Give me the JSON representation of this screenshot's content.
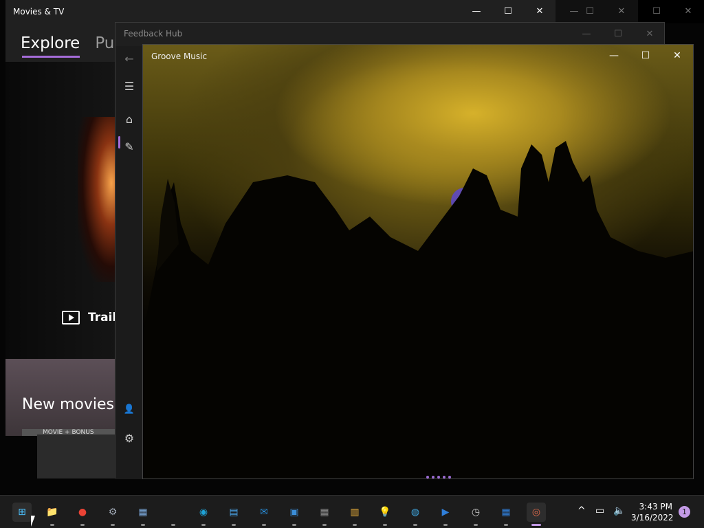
{
  "background_window": {
    "controls": [
      "—",
      "☐",
      "✕"
    ]
  },
  "movies": {
    "title": "Movies & TV",
    "tabs": [
      {
        "label": "Explore"
      },
      {
        "label": "Purc"
      }
    ],
    "trailer_label": "Trail",
    "section_title": "New movies",
    "bonus_label": "MOVIE + BONUS"
  },
  "feedback": {
    "title": "Feedback Hub",
    "nav": {
      "back": "←",
      "menu": "☰",
      "home": "⌂",
      "feedback": "✎",
      "account": "👤",
      "settings": "⚙"
    }
  },
  "groove": {
    "title": "Groove Music"
  },
  "taskbar": {
    "apps": [
      {
        "name": "start",
        "glyph": "⊞",
        "color": "#4cc2ff"
      },
      {
        "name": "file-explorer",
        "glyph": "📁",
        "color": "#f4c542"
      },
      {
        "name": "chrome",
        "glyph": "●",
        "color": "#ea4335"
      },
      {
        "name": "settings",
        "glyph": "⚙",
        "color": "#9ea7b3"
      },
      {
        "name": "photos-viewer",
        "glyph": "▦",
        "color": "#7aa7d9"
      },
      {
        "name": "blank-app",
        "glyph": "",
        "color": "#333333"
      },
      {
        "name": "edge",
        "glyph": "◉",
        "color": "#1fa2d6"
      },
      {
        "name": "notepad",
        "glyph": "▤",
        "color": "#4aa3e8"
      },
      {
        "name": "mail",
        "glyph": "✉",
        "color": "#2a8dd8"
      },
      {
        "name": "photos",
        "glyph": "▣",
        "color": "#3b8ed8"
      },
      {
        "name": "calculator",
        "glyph": "▦",
        "color": "#8a8a8a"
      },
      {
        "name": "store",
        "glyph": "▥",
        "color": "#f0b43c"
      },
      {
        "name": "tips",
        "glyph": "💡",
        "color": "#2fb1e8"
      },
      {
        "name": "maps",
        "glyph": "◍",
        "color": "#3fa7e0"
      },
      {
        "name": "movies-tv",
        "glyph": "▶",
        "color": "#2f7ed8"
      },
      {
        "name": "clock",
        "glyph": "◷",
        "color": "#cfcfcf"
      },
      {
        "name": "calendar",
        "glyph": "▦",
        "color": "#2f7ed8"
      },
      {
        "name": "groove",
        "glyph": "◎",
        "color": "#e06a4a"
      }
    ],
    "time": "3:43 PM",
    "date": "3/16/2022",
    "notification_count": "1"
  }
}
